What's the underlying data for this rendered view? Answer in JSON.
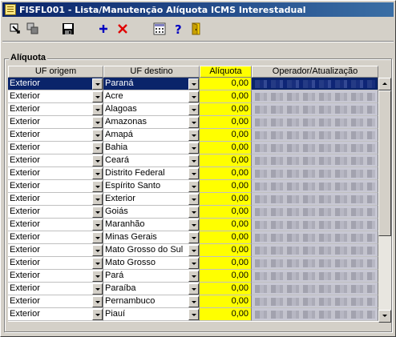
{
  "window": {
    "title": "FISFL001 - Lista/Manutenção Alíquota ICMS Interestadual"
  },
  "toolbar": {
    "buttons": [
      {
        "name": "export-icon"
      },
      {
        "name": "copy-icon"
      },
      {
        "name": "save-icon"
      },
      {
        "name": "add-icon"
      },
      {
        "name": "delete-icon"
      },
      {
        "name": "calculator-icon"
      },
      {
        "name": "help-icon"
      },
      {
        "name": "exit-icon"
      }
    ]
  },
  "group": {
    "label": "Alíquota"
  },
  "grid": {
    "columns": [
      {
        "label": "UF origem",
        "highlight": false
      },
      {
        "label": "UF destino",
        "highlight": false
      },
      {
        "label": "Alíquota",
        "highlight": true
      },
      {
        "label": "Operador/Atualização",
        "highlight": false
      }
    ],
    "rows": [
      {
        "origem": "Exterior",
        "destino": "Paraná",
        "aliquota": "0,00",
        "selected": true
      },
      {
        "origem": "Exterior",
        "destino": "Acre",
        "aliquota": "0,00"
      },
      {
        "origem": "Exterior",
        "destino": "Alagoas",
        "aliquota": "0,00"
      },
      {
        "origem": "Exterior",
        "destino": "Amazonas",
        "aliquota": "0,00"
      },
      {
        "origem": "Exterior",
        "destino": "Amapá",
        "aliquota": "0,00"
      },
      {
        "origem": "Exterior",
        "destino": "Bahia",
        "aliquota": "0,00"
      },
      {
        "origem": "Exterior",
        "destino": "Ceará",
        "aliquota": "0,00"
      },
      {
        "origem": "Exterior",
        "destino": "Distrito Federal",
        "aliquota": "0,00"
      },
      {
        "origem": "Exterior",
        "destino": "Espírito Santo",
        "aliquota": "0,00"
      },
      {
        "origem": "Exterior",
        "destino": "Exterior",
        "aliquota": "0,00"
      },
      {
        "origem": "Exterior",
        "destino": "Goiás",
        "aliquota": "0,00"
      },
      {
        "origem": "Exterior",
        "destino": "Maranhão",
        "aliquota": "0,00"
      },
      {
        "origem": "Exterior",
        "destino": "Minas Gerais",
        "aliquota": "0,00"
      },
      {
        "origem": "Exterior",
        "destino": "Mato Grosso do Sul",
        "aliquota": "0,00"
      },
      {
        "origem": "Exterior",
        "destino": "Mato Grosso",
        "aliquota": "0,00"
      },
      {
        "origem": "Exterior",
        "destino": "Pará",
        "aliquota": "0,00"
      },
      {
        "origem": "Exterior",
        "destino": "Paraíba",
        "aliquota": "0,00"
      },
      {
        "origem": "Exterior",
        "destino": "Pernambuco",
        "aliquota": "0,00"
      },
      {
        "origem": "Exterior",
        "destino": "Piauí",
        "aliquota": "0,00"
      }
    ]
  },
  "colors": {
    "selection": "#0a246a",
    "aliquota_column": "#ffff00",
    "title_gradient_start": "#0a246a",
    "title_gradient_end": "#3a6ea5"
  }
}
